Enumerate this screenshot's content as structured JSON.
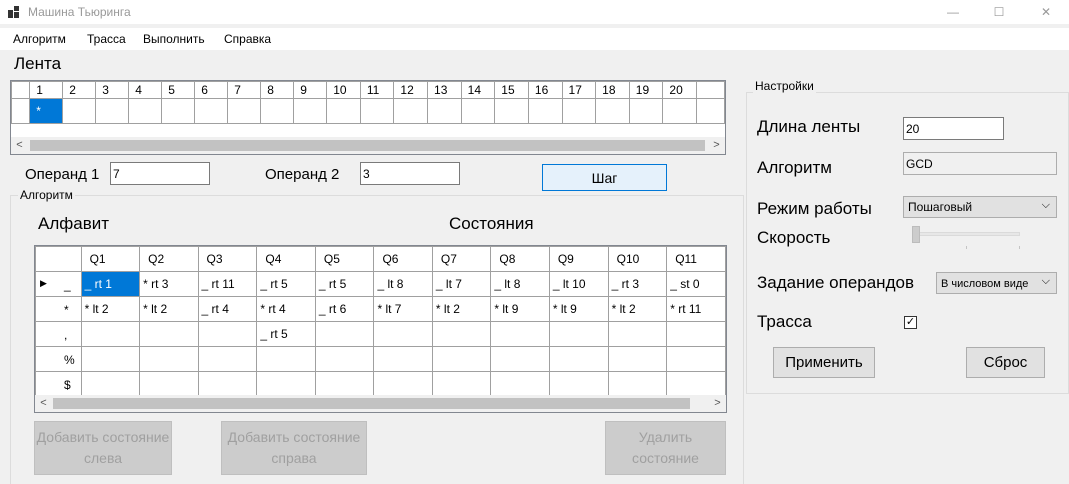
{
  "window": {
    "title": "Машина Тьюринга",
    "minimize_glyph": "—",
    "maximize_glyph": "☐",
    "close_glyph": "✕"
  },
  "menu": [
    "Алгоритм",
    "Трасса",
    "Выполнить",
    "Справка"
  ],
  "tape": {
    "title": "Лента",
    "columns": [
      "1",
      "2",
      "3",
      "4",
      "5",
      "6",
      "7",
      "8",
      "9",
      "10",
      "11",
      "12",
      "13",
      "14",
      "15",
      "16",
      "17",
      "18",
      "19",
      "20"
    ],
    "values": [
      "*",
      "",
      "",
      "",
      "",
      "",
      "",
      "",
      "",
      "",
      "",
      "",
      "",
      "",
      "",
      "",
      "",
      "",
      "",
      ""
    ]
  },
  "operands": {
    "operand1_label": "Операнд 1",
    "operand1_value": "7",
    "operand2_label": "Операнд 2",
    "operand2_value": "3",
    "step_button": "Шаг"
  },
  "algorithm": {
    "group_title": "Алгоритм",
    "alphabet_label": "Алфавит",
    "states_label": "Состояния",
    "state_headers": [
      "Q1",
      "Q2",
      "Q3",
      "Q4",
      "Q5",
      "Q6",
      "Q7",
      "Q8",
      "Q9",
      "Q10",
      "Q11"
    ],
    "rows": [
      {
        "symbol": "_",
        "cells": [
          "_ rt 1",
          "* rt 3",
          "_ rt 11",
          "_ rt 5",
          "_ rt 5",
          "_ lt 8",
          "_ lt 7",
          "_ lt 8",
          "_ lt 10",
          "_ rt 3",
          "_ st 0"
        ]
      },
      {
        "symbol": "*",
        "cells": [
          "* lt 2",
          "* lt 2",
          "_ rt 4",
          "* rt 4",
          "_ rt 6",
          "* lt 7",
          "* lt 2",
          "* lt 9",
          "* lt 9",
          "* lt 2",
          "* rt 11"
        ]
      },
      {
        "symbol": ",",
        "cells": [
          "",
          "",
          "",
          "_ rt 5",
          "",
          "",
          "",
          "",
          "",
          "",
          ""
        ]
      },
      {
        "symbol": "%",
        "cells": [
          "",
          "",
          "",
          "",
          "",
          "",
          "",
          "",
          "",
          "",
          ""
        ]
      },
      {
        "symbol": "$",
        "cells": [
          "",
          "",
          "",
          "",
          "",
          "",
          "",
          "",
          "",
          "",
          ""
        ]
      }
    ],
    "add_left_button": "Добавить состояние слева",
    "add_right_button": "Добавить состояние справа",
    "delete_button": "Удалить состояние"
  },
  "settings": {
    "group_title": "Настройки",
    "tape_length_label": "Длина ленты",
    "tape_length_value": "20",
    "algorithm_label": "Алгоритм",
    "algorithm_value": "GCD",
    "mode_label": "Режим работы",
    "mode_value": "Пошаговый",
    "speed_label": "Скорость",
    "operand_mode_label": "Задание операндов",
    "operand_mode_value": "В числовом виде",
    "trace_label": "Трасса",
    "trace_checked_glyph": "✓",
    "apply_button": "Применить",
    "reset_button": "Сброс"
  },
  "icons": {
    "row_pointer": "▶",
    "scroll_left": "<",
    "scroll_right": ">",
    "dropdown": "⌵"
  }
}
